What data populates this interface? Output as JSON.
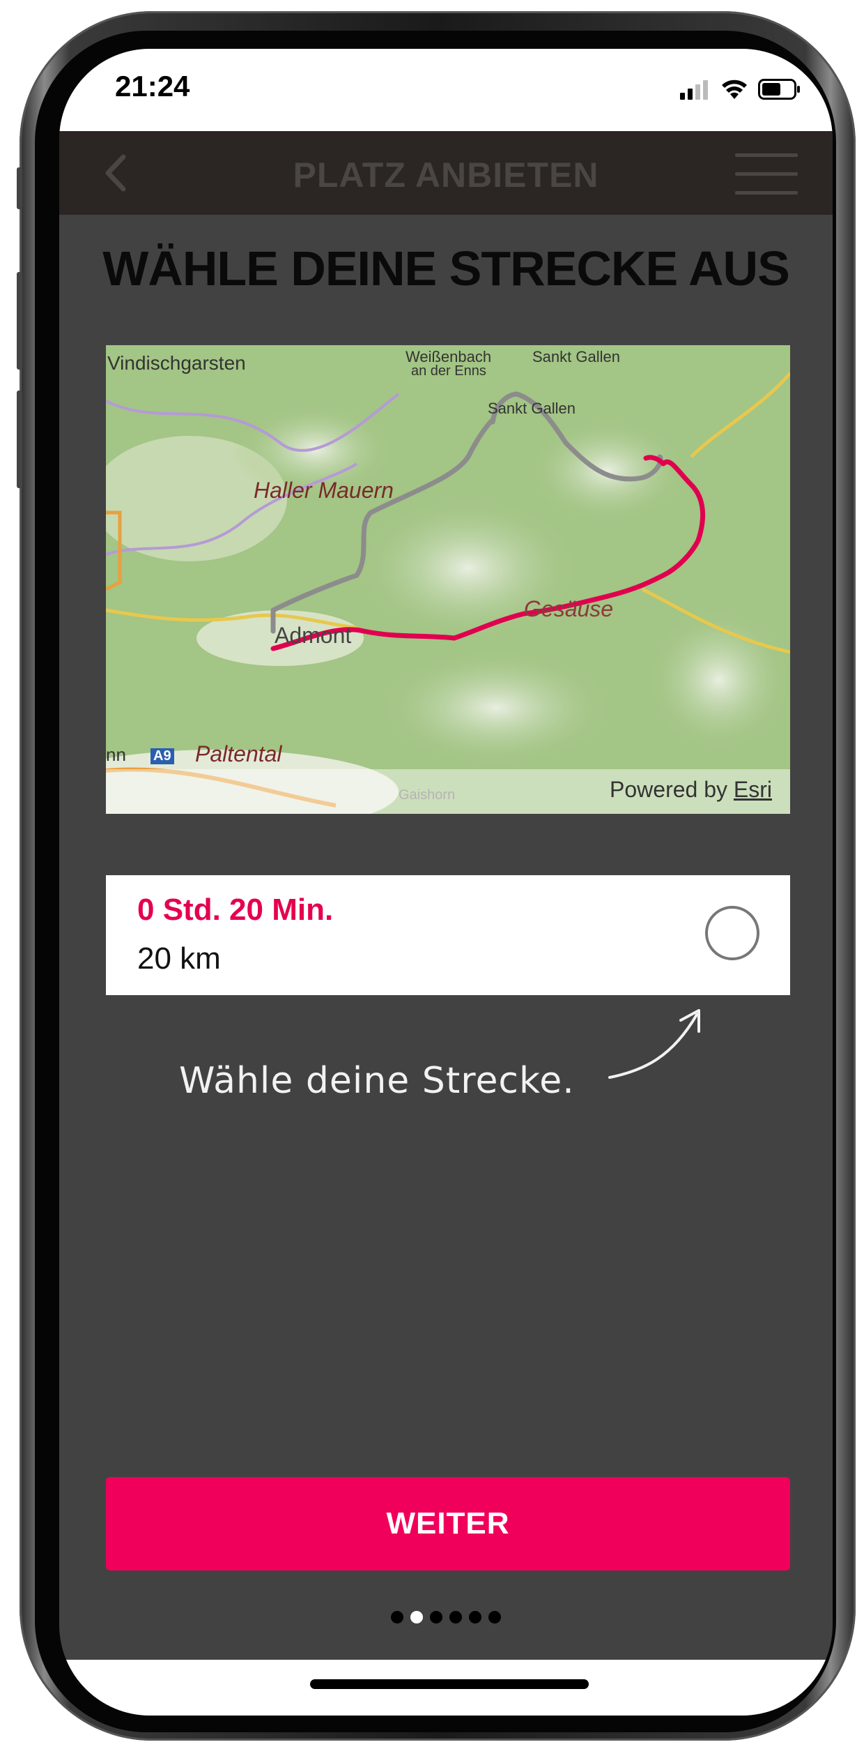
{
  "status_bar": {
    "time": "21:24"
  },
  "nav": {
    "title": "PLATZ ANBIETEN"
  },
  "heading": "WÄHLE DEINE STRECKE AUS",
  "map": {
    "places": {
      "windischgarsten": "Vindischgarsten",
      "weissenbach": "Weißenbach an der Enns",
      "weissenbach_line1": "Weißenbach",
      "weissenbach_line2": "an der Enns",
      "sankt_gallen_top": "Sankt Gallen",
      "sankt_gallen": "Sankt Gallen",
      "haller_mauern": "Haller Mauern",
      "admont": "Admont",
      "gesause": "Gesäuse",
      "paltental": "Paltental",
      "enns": "nn",
      "a9": "A9",
      "gaishorn": "Gaishorn"
    },
    "attribution_prefix": "Powered by ",
    "attribution_link": "Esri",
    "colors": {
      "route_selected": "#e0004f",
      "route_alternative": "#8c8c8c"
    }
  },
  "route_option": {
    "duration": "0 Std. 20 Min.",
    "distance": "20 km",
    "selected": false
  },
  "hint": "Wähle deine Strecke.",
  "cta": {
    "label": "WEITER"
  },
  "pager": {
    "total": 6,
    "active_index": 1
  },
  "colors": {
    "accent": "#f0005a",
    "background": "#424242",
    "nav_background": "#2b2623"
  }
}
